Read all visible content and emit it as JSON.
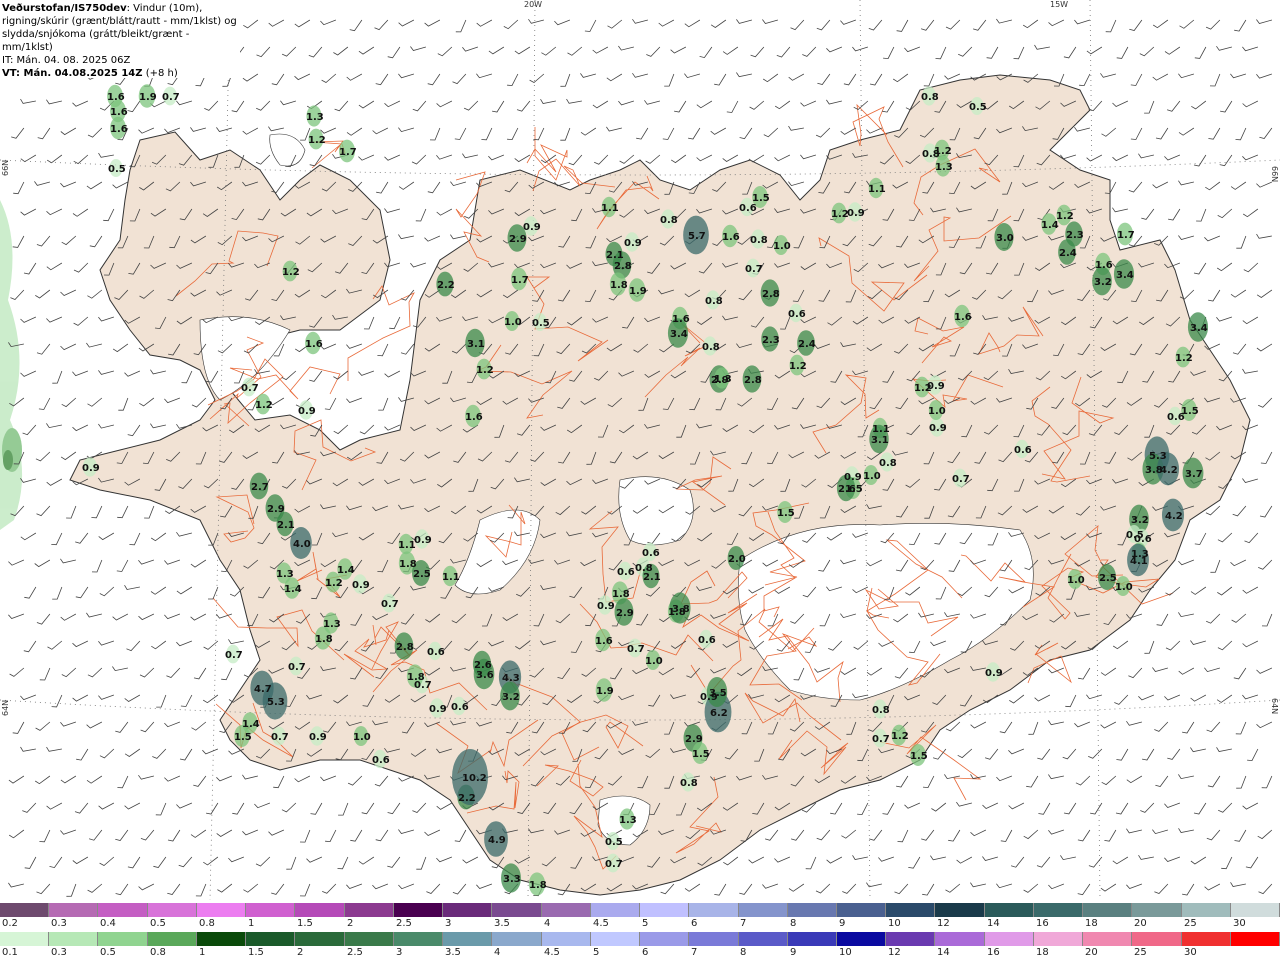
{
  "title": {
    "line1_bold": "Veðurstofan/IS750dev",
    "line1_rest": ": Vindur (10m),",
    "line2": "rigning/skúrir (grænt/blátt/rautt - mm/1klst) og",
    "line3": "slydda/snjókoma (grátt/bleikt/grænt - mm/1klst)",
    "line4": "IT: Mán. 04. 08. 2025 06Z",
    "line5_bold": "VT: Mán. 04.08.2025 14Z",
    "line5_rest": " (+8 h)"
  },
  "grid_labels": {
    "lon_20w": "20W",
    "lon_15w": "15W",
    "lat_66n": "66N",
    "lat_64n": "64N"
  },
  "colors": {
    "land": "#f1e2d4",
    "roads": "#e86a3a",
    "ice": "#ffffff",
    "coast": "#333333"
  },
  "legend": {
    "snow_labels": [
      "0.2",
      "0.3",
      "0.4",
      "0.5",
      "0.8",
      "1",
      "1.5",
      "2",
      "2.5",
      "3",
      "3.5",
      "4",
      "4.5",
      "5",
      "6",
      "7",
      "8",
      "9",
      "10",
      "12",
      "14",
      "16",
      "18",
      "20",
      "25",
      "30"
    ],
    "snow_colors": [
      "#6e4a6e",
      "#b56ab3",
      "#c45ec3",
      "#d873d9",
      "#ec7df0",
      "#d060d0",
      "#b54ab8",
      "#8c3a90",
      "#4a0050",
      "#6a2a7a",
      "#7a4a90",
      "#9a6ab0",
      "#aaaaee",
      "#c0c0ff",
      "#a8b4e8",
      "#8494cc",
      "#6878b0",
      "#4a6090",
      "#2a4a6a",
      "#1a3a4a",
      "#2a5a5a",
      "#3a6a6a",
      "#5a8080",
      "#7a9a9a",
      "#a0bcbc",
      "#d0dcdc"
    ],
    "rain_labels": [
      "0.1",
      "0.3",
      "0.5",
      "0.8",
      "1",
      "1.5",
      "2",
      "2.5",
      "3",
      "3.5",
      "4",
      "4.5",
      "5",
      "6",
      "7",
      "8",
      "9",
      "10",
      "12",
      "14",
      "16",
      "18",
      "20",
      "25",
      "30"
    ],
    "rain_colors": [
      "#d6f5d6",
      "#b6e8b6",
      "#90d490",
      "#5aa85a",
      "#0a4a0a",
      "#1a5a2a",
      "#2a6a3a",
      "#3a7a4a",
      "#4a8a6a",
      "#6a9aaa",
      "#8aa8cc",
      "#a8b8ee",
      "#c0c8ff",
      "#9a9ae8",
      "#7a7ad8",
      "#5a5ac8",
      "#3a3ab8",
      "#0a0aa0",
      "#6a3ab0",
      "#aa6ad8",
      "#e09ae8",
      "#f0a8d8",
      "#f088b0",
      "#f06888",
      "#f03030",
      "#ff0000"
    ]
  },
  "precip_values": [
    "1.6",
    "1.9",
    "0.7",
    "1.6",
    "1.6",
    "1.3",
    "1.2",
    "1.7",
    "0.5",
    "1.2",
    "2.2",
    "1.6",
    "0.7",
    "1.2",
    "0.9",
    "0.9",
    "2.7",
    "2.9",
    "2.1",
    "4.0",
    "1.1",
    "0.9",
    "1.8",
    "2.5",
    "1.1",
    "1.3",
    "1.4",
    "1.2",
    "1.4",
    "0.9",
    "1.3",
    "1.8",
    "0.7",
    "0.7",
    "0.7",
    "4.7",
    "5.3",
    "1.4",
    "1.5",
    "0.7",
    "0.9",
    "1.0",
    "0.6",
    "3.1",
    "1.2",
    "2.9",
    "0.9",
    "1.7",
    "1.0",
    "0.5",
    "1.1",
    "0.8",
    "0.9",
    "5.7",
    "2.8",
    "2.1",
    "1.8",
    "1.9",
    "1.6",
    "3.4",
    "0.8",
    "0.8",
    "2.9",
    "2.8",
    "2.3",
    "0.6",
    "2.4",
    "1.2",
    "1.3",
    "2.8",
    "1.6",
    "1.1",
    "3.1",
    "0.8",
    "0.9",
    "1.0",
    "0.9",
    "1.2",
    "0.9",
    "1.5",
    "2.6",
    "1.0",
    "0.6",
    "0.7",
    "3.0",
    "1.6",
    "3.2",
    "3.4",
    "1.2",
    "1.4",
    "2.3",
    "2.4",
    "1.7",
    "3.4",
    "1.2",
    "1.5",
    "0.6",
    "5.3",
    "3.8",
    "4.2",
    "3.7",
    "4.2",
    "3.2",
    "0.6",
    "0.5",
    "1.3",
    "4.1",
    "2.5",
    "1.0",
    "1.0",
    "0.9",
    "0.8",
    "1.2",
    "0.7",
    "1.5",
    "0.8",
    "1.3",
    "1.2",
    "0.9",
    "1.2",
    "1.1",
    "0.8",
    "0.5",
    "1.6",
    "1.5",
    "0.8",
    "1.6",
    "0.7",
    "1.0",
    "0.6",
    "1.5",
    "2.0",
    "0.6",
    "0.6",
    "1.8",
    "0.8",
    "2.9",
    "0.9",
    "2.1",
    "1.8",
    "1.6",
    "1.9",
    "0.7",
    "1.0",
    "0.6",
    "3.8",
    "0.9",
    "6.2",
    "3.5",
    "2.9",
    "1.5",
    "0.8",
    "1.3",
    "0.5",
    "0.7",
    "3.3",
    "1.8",
    "2.2",
    "10.2",
    "4.9",
    "3.6",
    "2.6",
    "4.3",
    "3.2",
    "0.6",
    "0.9",
    "0.7",
    "0.6",
    "2.8",
    "1.8",
    "0.9"
  ]
}
